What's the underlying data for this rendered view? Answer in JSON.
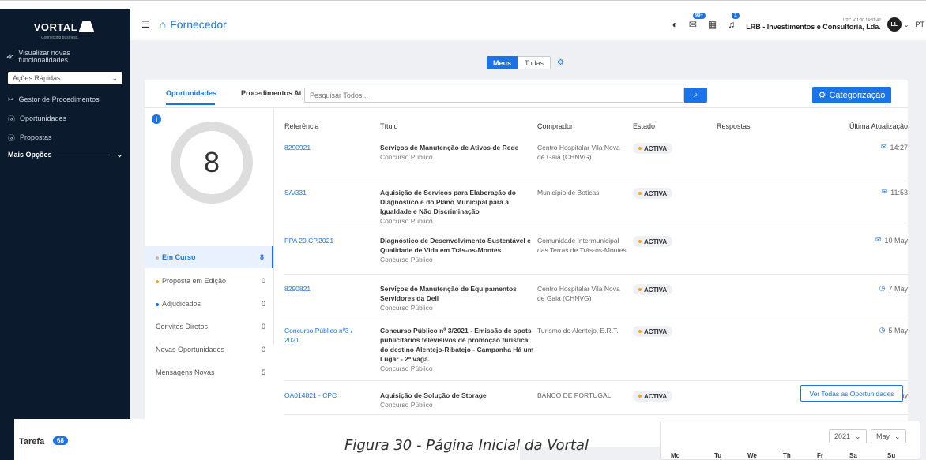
{
  "sidebar": {
    "logo": "VORTAL",
    "logo_sub": "Connecting business.",
    "whats_new_line1": "Visualizar novas",
    "whats_new_line2": "funcionalidades",
    "quick_actions": "Ações Rápidas",
    "items": [
      {
        "label": "Gestor de Procedimentos"
      },
      {
        "label": "Oportunidades"
      },
      {
        "label": "Propostas"
      }
    ],
    "more": "Mais Opções"
  },
  "header": {
    "app_title": "Fornecedor",
    "notifications_badge": "99+",
    "alerts_badge": "1",
    "timezone": "UTC +01:00 14:31:42",
    "company": "LRB - Investimentos e Consultoria, Lda.",
    "avatar": "LL",
    "language": "PT"
  },
  "toggle": {
    "mine": "Meus",
    "all": "Todas"
  },
  "tabs": {
    "opportunities": "Oportunidades",
    "procedures": "Procedimentos At"
  },
  "search": {
    "placeholder": "Pesquisar Todos..."
  },
  "categorize_button": "Categorização",
  "summary": {
    "total": "8",
    "stats": [
      {
        "label": "Em Curso",
        "count": "8",
        "dot": "#bbbbbb"
      },
      {
        "label": "Proposta em Edição",
        "count": "0",
        "dot": "#f5a623"
      },
      {
        "label": "Adjudicados",
        "count": "0",
        "dot": "#1a73e8"
      },
      {
        "label": "Convites Diretos",
        "count": "0"
      },
      {
        "label": "Novas Oportunidades",
        "count": "0"
      },
      {
        "label": "Mensagens Novas",
        "count": "5"
      }
    ]
  },
  "table": {
    "headers": [
      "Referência",
      "Título",
      "Comprador",
      "Estado",
      "Respostas",
      "Última Atualização"
    ],
    "rows": [
      {
        "ref": "8290921",
        "title": "Serviços de Manutenção de Ativos de Rede",
        "type": "Concurso Público",
        "buyer": "Centro Hospitalar Vila Nova de Gaia (CHNVG)",
        "state": "ACTIVA",
        "updated": "14:27",
        "icon": "mail-icon"
      },
      {
        "ref": "SA/331",
        "title": "Aquisição de Serviços para Elaboração do Diagnóstico e do Plano Municipal para a Igualdade e Não Discriminação",
        "type": "Concurso Público",
        "buyer": "Município de Boticas",
        "state": "ACTIVA",
        "updated": "11:53",
        "icon": "mail-icon"
      },
      {
        "ref": "PPA 20.CP.2021",
        "title": "Diagnóstico de Desenvolvimento Sustentável e Qualidade de Vida em Trás-os-Montes",
        "type": "Concurso Público",
        "buyer": "Comunidade Intermunicipal das Terras de Trás-os-Montes",
        "state": "ACTIVA",
        "updated": "10 May",
        "icon": "mail-icon"
      },
      {
        "ref": "8290821",
        "title": "Serviços de Manutenção de Equipamentos Servidores da Dell",
        "type": "Concurso Público",
        "buyer": "Centro Hospitalar Vila Nova de Gaia (CHNVG)",
        "state": "ACTIVA",
        "updated": "7 May",
        "icon": "clock-icon"
      },
      {
        "ref": "Concurso Público nº3 / 2021",
        "title": "Concurso Público nº 3/2021 - Emissão de spots publicitários televisivos de promoção turística do destino Alentejo-Ribatejo - Campanha Há um Lugar - 2ª vaga.",
        "type": "Concurso Público",
        "buyer": "Turismo do Alentejo, E.R.T.",
        "state": "ACTIVA",
        "updated": "5 May",
        "icon": "clock-icon"
      },
      {
        "ref": "OA014821 - CPC",
        "title": "Aquisição de Solução de Storage",
        "type": "Concurso Público",
        "buyer": "BANCO DE PORTUGAL",
        "state": "ACTIVA",
        "updated": "3 May",
        "icon": "mail-icon"
      }
    ]
  },
  "view_all": "Ver Todas as Oportunidades",
  "tasks": {
    "label": "Tarefa",
    "count": "68"
  },
  "calendar": {
    "year": "2021",
    "month": "May",
    "days": [
      "Mo",
      "Tu",
      "We",
      "Th",
      "Fr",
      "Sa",
      "Su"
    ]
  },
  "caption": "Figura 30 - Página Inicial da Vortal"
}
